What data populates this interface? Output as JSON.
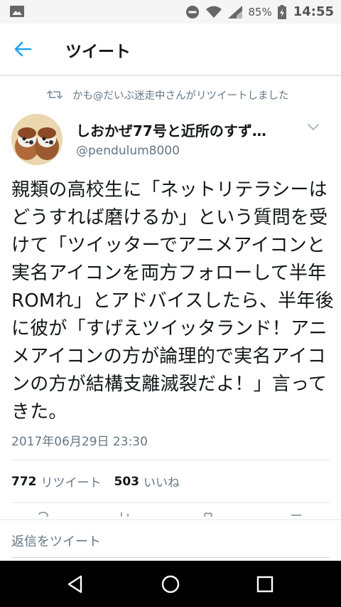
{
  "status_bar": {
    "battery_text": "85%",
    "time": "14:55",
    "icons": [
      "photo-icon",
      "do-not-disturb-icon",
      "wifi-icon",
      "signal-icon",
      "battery-icon"
    ]
  },
  "app_bar": {
    "title": "ツイート",
    "back_icon": "back-arrow-icon",
    "accent": "#1da1f2"
  },
  "retweet_info": {
    "text": "かも@だいぶ迷走中さんがリツイートしました",
    "icon": "retweet-icon"
  },
  "author": {
    "name": "しおかぜ77号と近所のすず…",
    "handle": "@pendulum8000"
  },
  "tweet": {
    "text": "親類の高校生に「ネットリテラシーはどうすれば磨けるか」という質問を受けて「ツイッターでアニメアイコンと実名アイコンを両方フォローして半年ROMれ」とアドバイスしたら、半年後に彼が「すげえツイッタランド！アニメアイコンの方が論理的で実名アイコンの方が結構支離滅裂だよ！」言ってきた。",
    "timestamp": "2017年06月29日 23:30"
  },
  "stats": {
    "retweets_count": "772",
    "retweets_label": "リツイート",
    "likes_count": "503",
    "likes_label": "いいね"
  },
  "reply": {
    "placeholder": "返信をツイート"
  },
  "nav_bar": {
    "icons": [
      "nav-back-icon",
      "nav-home-icon",
      "nav-recents-icon"
    ]
  }
}
